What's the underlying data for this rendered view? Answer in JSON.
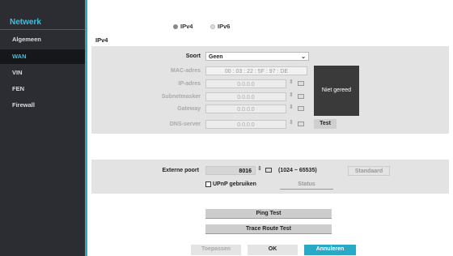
{
  "sidebar": {
    "title": "Netwerk",
    "items": [
      {
        "label": "Algemeen"
      },
      {
        "label": "WAN"
      },
      {
        "label": "VIN"
      },
      {
        "label": "FEN"
      },
      {
        "label": "Firewall"
      }
    ],
    "active": "WAN"
  },
  "radios": {
    "ipv4": "IPv4",
    "ipv6": "IPv6"
  },
  "section_title": "IPv4",
  "form": {
    "soort_label": "Soort",
    "soort_value": "Geen",
    "mac_label": "MAC-adres",
    "mac_value": "00 : 03 : 22 : 5F : 97 : DE",
    "ip_label": "IP-adres",
    "ip_value": "0.0.0.0",
    "subnet_label": "Subnetmasker",
    "subnet_value": "0.0.0.0",
    "gateway_label": "Gateway",
    "gateway_value": "0.0.0.0",
    "dns_label": "DNS-server",
    "dns_value": "0.0.0.0",
    "test_button": "Test",
    "status_text": "Niet gereed"
  },
  "port": {
    "label": "Externe poort",
    "value": "8016",
    "range": "(1024 ~ 65535)",
    "default_button": "Standaard",
    "upnp_label": "UPnP gebruiken",
    "status_button": "Status"
  },
  "tests": {
    "ping": "Ping Test",
    "trace": "Trace Route Test"
  },
  "footer": {
    "apply": "Toepassen",
    "ok": "OK",
    "cancel": "Annuleren"
  },
  "colors": {
    "accent": "#2aa9c7",
    "cancel_bg": "#2aa9c7"
  }
}
